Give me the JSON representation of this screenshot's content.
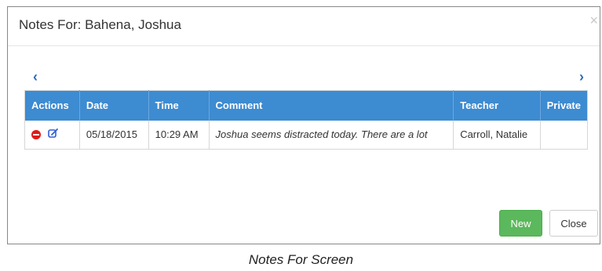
{
  "dialog": {
    "title": "Notes For: Bahena, Joshua",
    "close_symbol": "×",
    "prev_symbol": "‹",
    "next_symbol": "›"
  },
  "table": {
    "headers": {
      "actions": "Actions",
      "date": "Date",
      "time": "Time",
      "comment": "Comment",
      "teacher": "Teacher",
      "private": "Private"
    },
    "rows": [
      {
        "date": "05/18/2015",
        "time": "10:29 AM",
        "comment": "Joshua seems distracted today. There are a lot",
        "teacher": "Carroll, Natalie",
        "private": ""
      }
    ]
  },
  "footer": {
    "new_label": "New",
    "close_label": "Close"
  },
  "caption": "Notes For Screen",
  "colors": {
    "header_blue": "#3d8bd1",
    "new_green": "#5cb85c",
    "delete_red": "#e01a1a",
    "edit_blue": "#2f5fd6"
  }
}
